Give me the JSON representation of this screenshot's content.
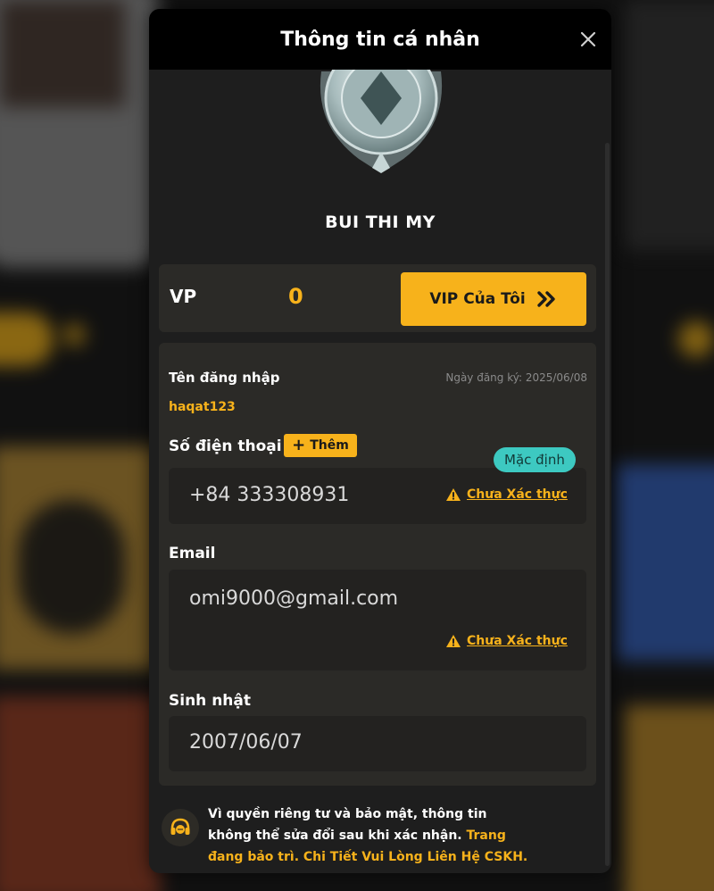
{
  "modal": {
    "title": "Thông tin cá nhân",
    "username": "BUI THI MY"
  },
  "vip": {
    "label": "VP",
    "value": "0",
    "button_label": "VIP Của Tôi"
  },
  "account": {
    "login_label": "Tên đăng nhập",
    "login_value": "haqat123",
    "registered_date": "Ngày đăng ký: 2025/06/08",
    "phone_label": "Số điện thoại",
    "add_label": "Thêm",
    "phone_value": "+84 333308931",
    "default_badge": "Mặc định",
    "phone_status": "Chưa Xác thực",
    "email_label": "Email",
    "email_value": "omi9000@gmail.com",
    "email_status": "Chưa Xác thực",
    "birthday_label": "Sinh nhật",
    "birthday_value": "2007/06/07"
  },
  "notice": {
    "text": "Vì quyền riêng tư và bảo mật, thông tin không thể sửa đổi sau khi xác nhận.",
    "highlight": " Trang đang bảo trì. Chi Tiết Vui Lòng Liên Hệ CSKH.",
    "suffix": " ."
  },
  "colors": {
    "accent": "#f7b21b",
    "badge": "#3dc9c1",
    "panel": "#2b2a27",
    "header": "#000000"
  }
}
